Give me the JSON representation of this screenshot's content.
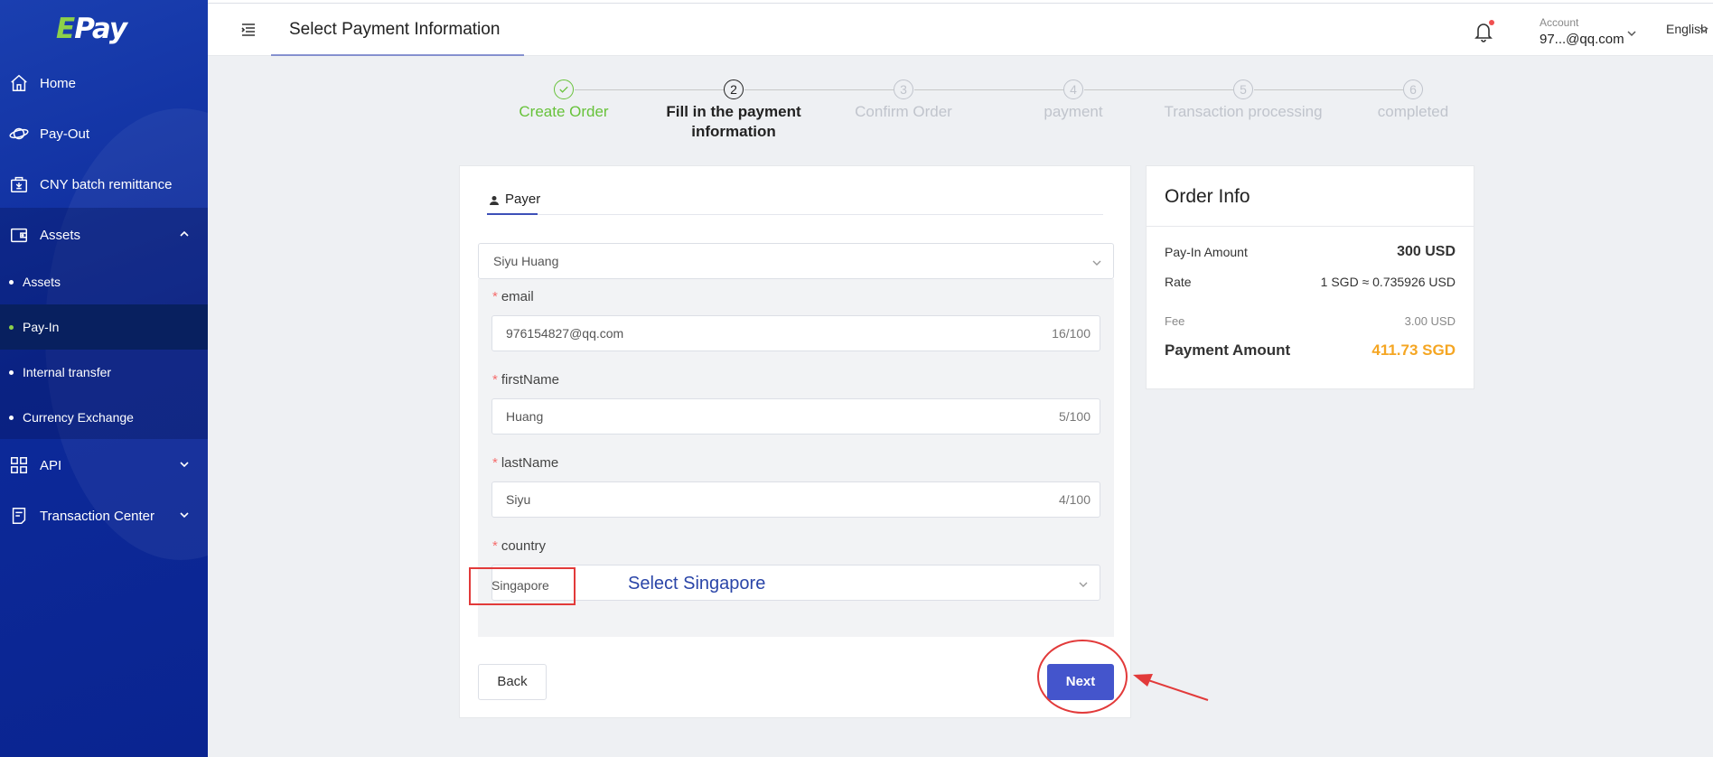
{
  "sidebar": {
    "logo_prefix": "E",
    "logo_rest": "Pay",
    "items": [
      {
        "label": "Home",
        "icon": "home-icon"
      },
      {
        "label": "Pay-Out",
        "icon": "planet-icon"
      },
      {
        "label": "CNY batch remittance",
        "icon": "batch-remittance-icon"
      },
      {
        "label": "Assets",
        "icon": "wallet-icon"
      },
      {
        "label": "API",
        "icon": "grid-icon"
      },
      {
        "label": "Transaction Center",
        "icon": "document-icon"
      }
    ],
    "sub_items": [
      {
        "label": "Assets"
      },
      {
        "label": "Pay-In"
      },
      {
        "label": "Internal transfer"
      },
      {
        "label": "Currency Exchange"
      }
    ],
    "accent_color": "#8dd04a"
  },
  "header": {
    "title": "Select Payment Information",
    "account_label": "Account",
    "account_value": "97...@qq.com",
    "language": "English"
  },
  "steps": [
    {
      "num": "",
      "label": "Create Order",
      "state": "done"
    },
    {
      "num": "2",
      "label": "Fill in the payment information",
      "state": "current"
    },
    {
      "num": "3",
      "label": "Confirm Order",
      "state": "pending"
    },
    {
      "num": "4",
      "label": "payment",
      "state": "pending"
    },
    {
      "num": "5",
      "label": "Transaction processing",
      "state": "pending"
    },
    {
      "num": "6",
      "label": "completed",
      "state": "pending"
    }
  ],
  "form": {
    "tab_label": "Payer",
    "payer_selected": "Siyu Huang",
    "fields": [
      {
        "label": "email",
        "value": "976154827@qq.com",
        "count": "16/100"
      },
      {
        "label": "firstName",
        "value": "Huang",
        "count": "5/100"
      },
      {
        "label": "lastName",
        "value": "Siyu",
        "count": "4/100"
      }
    ],
    "required_mark": "*",
    "country_label": "country",
    "country_value": "Singapore",
    "country_hint": "Select Singapore",
    "back_label": "Back",
    "next_label": "Next"
  },
  "order_info": {
    "title": "Order Info",
    "pay_in_amount_label": "Pay-In Amount",
    "pay_in_amount_value": "300 USD",
    "rate_label": "Rate",
    "rate_value": "1 SGD ≈ 0.735926 USD",
    "fee_label": "Fee",
    "fee_value": "3.00 USD",
    "payment_amount_label": "Payment Amount",
    "payment_amount_value": "411.73 SGD"
  },
  "colors": {
    "primary": "#4455cc",
    "success": "#67c23a",
    "annotation": "#e23a3a",
    "highlight": "#f5a623"
  }
}
